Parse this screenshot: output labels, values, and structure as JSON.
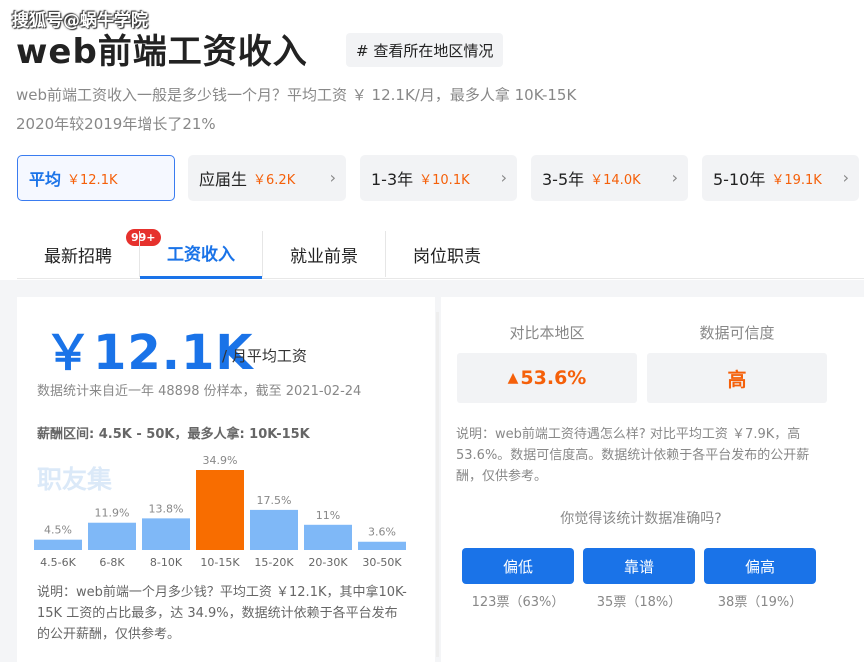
{
  "watermark": "搜狐号@蜗牛学院",
  "header": {
    "title": "web前端工资收入",
    "region_button": "# 查看所在地区情况",
    "desc_line1": "web前端工资收入一般是多少钱一个月？平均工资 ￥ 12.1K/月，最多人拿 10K-15K",
    "desc_line2": "2020年较2019年增长了21%"
  },
  "experience_cards": [
    {
      "label": "平均",
      "value": "￥12.1K"
    },
    {
      "label": "应届生",
      "value": "￥6.2K"
    },
    {
      "label": "1-3年",
      "value": "￥10.1K"
    },
    {
      "label": "3-5年",
      "value": "￥14.0K"
    },
    {
      "label": "5-10年",
      "value": "￥19.1K"
    }
  ],
  "tabs": [
    {
      "label": "最新招聘",
      "badge": "99+"
    },
    {
      "label": "工资收入"
    },
    {
      "label": "就业前景"
    },
    {
      "label": "岗位职责"
    }
  ],
  "salary": {
    "big_value": "￥12.1K",
    "unit_label": "/ 月平均工资",
    "stat_note": "数据统计来自近一年 48898 份样本，截至 2021-02-24",
    "range_note": "薪酬区间: 4.5K - 50K，最多人拿:  10K-15K",
    "logo_text": "职友集",
    "explain": "说明：web前端一个月多少钱？平均工资 ￥12.1K，其中拿10K-15K 工资的占比最多，达 34.9%，数据统计依赖于各平台发布的公开薪酬，仅供参考。"
  },
  "chart_data": {
    "type": "bar",
    "categories": [
      "4.5-6K",
      "6-8K",
      "8-10K",
      "10-15K",
      "15-20K",
      "20-30K",
      "30-50K"
    ],
    "values": [
      4.5,
      11.9,
      13.8,
      34.9,
      17.5,
      11,
      3.6
    ],
    "value_labels": [
      "4.5%",
      "11.9%",
      "13.8%",
      "34.9%",
      "17.5%",
      "11%",
      "3.6%"
    ],
    "highlight_index": 3,
    "colors": {
      "bar": "#7fb8f7",
      "highlight": "#f86d00"
    },
    "title": "",
    "xlabel": "",
    "ylabel": ""
  },
  "comparison": {
    "local_label": "对比本地区",
    "local_value": "53.6%",
    "trust_label": "数据可信度",
    "trust_value": "高",
    "explain": "说明：web前端工资待遇怎么样? 对比平均工资 ￥7.9K，高53.6%。数据可信度高。数据统计依赖于各平台发布的公开薪酬，仅供参考。",
    "question": "你觉得该统计数据准确吗?",
    "votes": [
      {
        "label": "偏低",
        "count": "123票（63%）"
      },
      {
        "label": "靠谱",
        "count": "35票（18%）"
      },
      {
        "label": "偏高",
        "count": "38票（19%）"
      }
    ]
  },
  "colors": {
    "accent": "#1a73e8",
    "orange": "#f5600a",
    "badge": "#e6312d"
  }
}
